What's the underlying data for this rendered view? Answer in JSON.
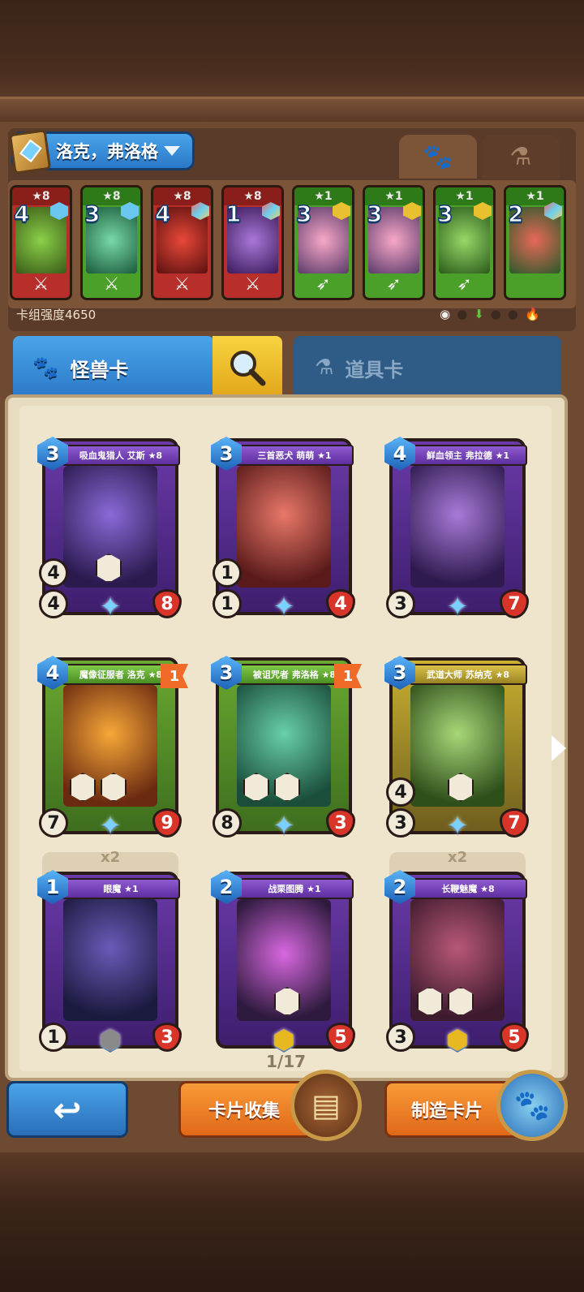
{
  "deck": {
    "name": "洛克，弗洛格",
    "strength": "卡组强度4650",
    "tabs": {
      "monster_icon": "paw-icon",
      "item_icon": "flask-icon"
    }
  },
  "deck_cards": [
    {
      "cost": "4",
      "stars": "★8",
      "color": "red"
    },
    {
      "cost": "3",
      "stars": "★8",
      "color": "green"
    },
    {
      "cost": "4",
      "stars": "★8",
      "color": "red"
    },
    {
      "cost": "1",
      "stars": "★8",
      "color": "red"
    },
    {
      "cost": "3",
      "stars": "★1",
      "color": "green"
    },
    {
      "cost": "3",
      "stars": "★1",
      "color": "green"
    },
    {
      "cost": "3",
      "stars": "★1",
      "color": "green"
    },
    {
      "cost": "2",
      "stars": "★1",
      "color": "green"
    }
  ],
  "categories": {
    "monster": "怪兽卡",
    "item": "道具卡"
  },
  "cards": [
    {
      "name": "吸血鬼猎人 艾斯 ★8",
      "cost": "3",
      "speed": "4",
      "attack": "4",
      "hp": "8"
    },
    {
      "name": "三首恶犬 萌萌 ★1",
      "cost": "3",
      "speed": "1",
      "attack": "1",
      "hp": "4"
    },
    {
      "name": "鲜血领主 弗拉德 ★1",
      "cost": "4",
      "speed": "",
      "attack": "3",
      "hp": "7"
    },
    {
      "name": "魔像征服者 洛克 ★8",
      "cost": "4",
      "speed": "",
      "attack": "7",
      "hp": "9",
      "rank": "1"
    },
    {
      "name": "被诅咒者 弗洛格 ★8",
      "cost": "3",
      "speed": "",
      "attack": "8",
      "hp": "3",
      "rank": "1"
    },
    {
      "name": "武道大师 苏纳克 ★8",
      "cost": "3",
      "speed": "4",
      "attack": "3",
      "hp": "7"
    },
    {
      "name": "眼魔 ★1",
      "cost": "1",
      "speed": "",
      "attack": "1",
      "hp": "3",
      "count": "x2"
    },
    {
      "name": "战栗图腾 ★1",
      "cost": "2",
      "speed": "",
      "attack": "",
      "hp": "5"
    },
    {
      "name": "长鞭魅魔 ★8",
      "cost": "2",
      "speed": "",
      "attack": "3",
      "hp": "5",
      "count": "x2"
    }
  ],
  "pagination": "1/17",
  "buttons": {
    "collect": "卡片收集",
    "craft": "制造卡片"
  }
}
